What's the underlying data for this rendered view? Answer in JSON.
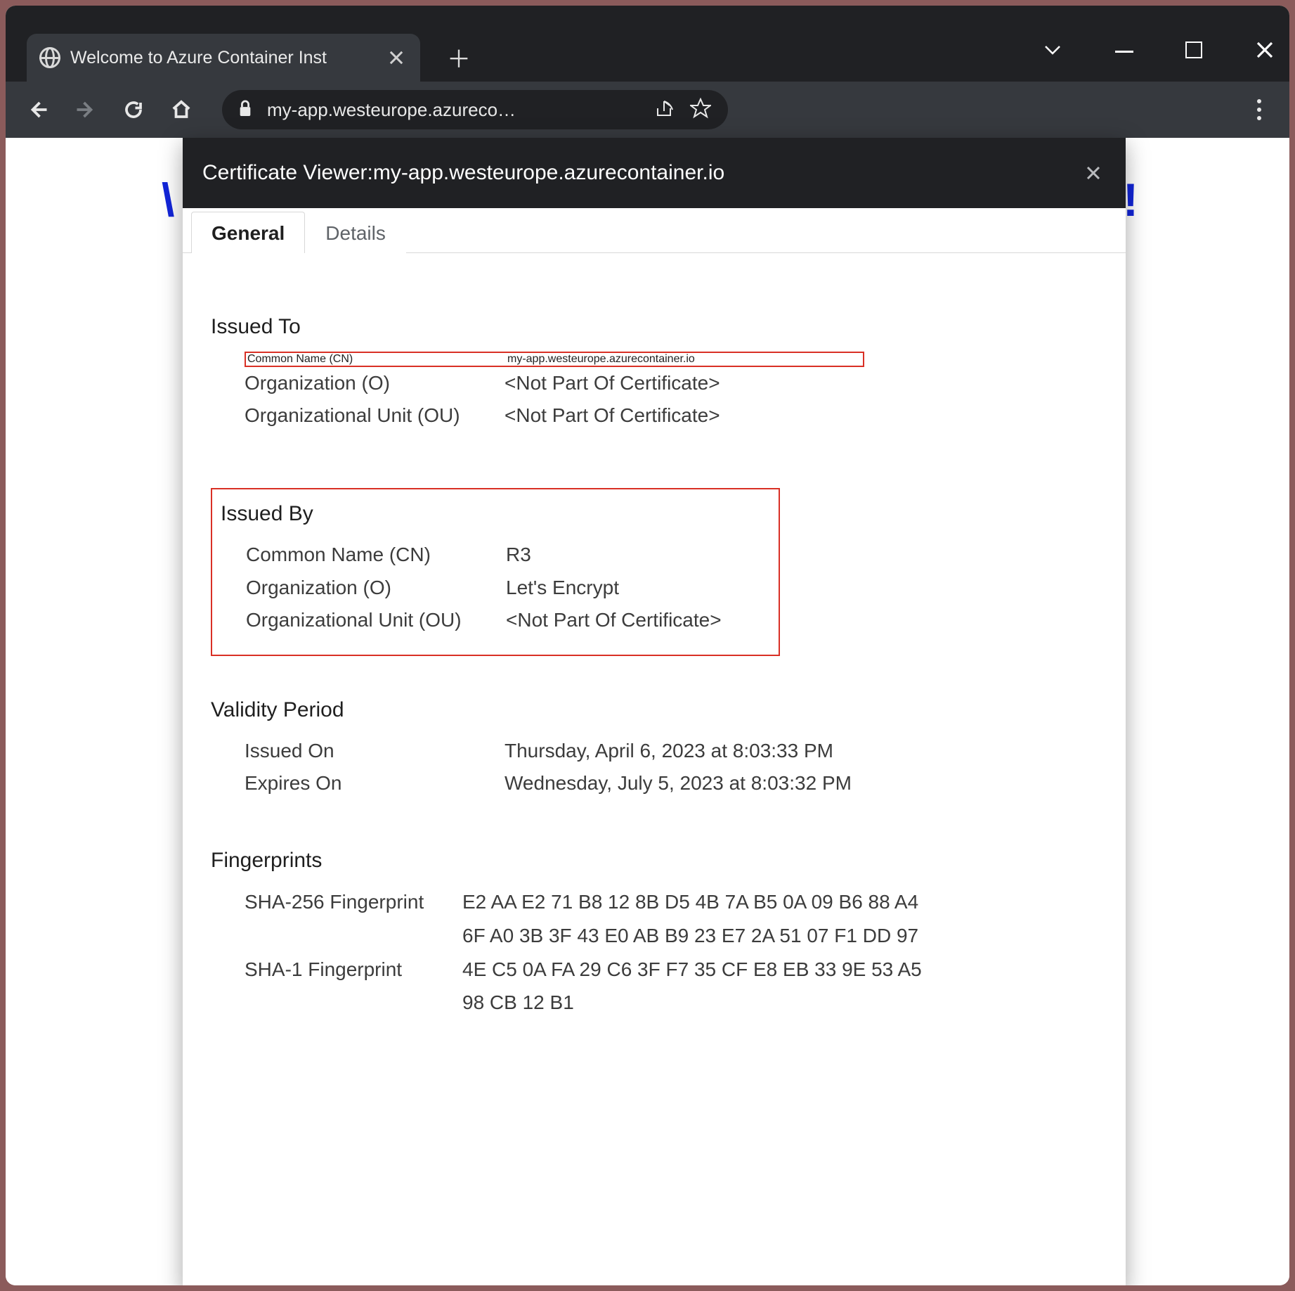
{
  "browser": {
    "tab_title": "Welcome to Azure Container Inst",
    "url_display": "my-app.westeurope.azureco…"
  },
  "dialog": {
    "title_prefix": "Certificate Viewer: ",
    "host": "my-app.westeurope.azurecontainer.io",
    "tabs": {
      "general": "General",
      "details": "Details"
    },
    "sections": {
      "issued_to": {
        "title": "Issued To",
        "cn_label": "Common Name (CN)",
        "cn_value": "my-app.westeurope.azurecontainer.io",
        "o_label": "Organization (O)",
        "o_value": "<Not Part Of Certificate>",
        "ou_label": "Organizational Unit (OU)",
        "ou_value": "<Not Part Of Certificate>"
      },
      "issued_by": {
        "title": "Issued By",
        "cn_label": "Common Name (CN)",
        "cn_value": "R3",
        "o_label": "Organization (O)",
        "o_value": "Let's Encrypt",
        "ou_label": "Organizational Unit (OU)",
        "ou_value": "<Not Part Of Certificate>"
      },
      "validity": {
        "title": "Validity Period",
        "issued_label": "Issued On",
        "issued_value": "Thursday, April 6, 2023 at 8:03:33 PM",
        "expires_label": "Expires On",
        "expires_value": "Wednesday, July 5, 2023 at 8:03:32 PM"
      },
      "fingerprints": {
        "title": "Fingerprints",
        "sha256_label": "SHA-256 Fingerprint",
        "sha256_line1": "E2 AA E2 71 B8 12 8B D5 4B 7A B5 0A 09 B6 88 A4",
        "sha256_line2": "6F A0 3B 3F 43 E0 AB B9 23 E7 2A 51 07 F1 DD 97",
        "sha1_label": "SHA-1 Fingerprint",
        "sha1_line1": "4E C5 0A FA 29 C6 3F F7 35 CF E8 EB 33 9E 53 A5",
        "sha1_line2": "98 CB 12 B1"
      }
    }
  },
  "page": {
    "heading_left_fragment": "\\",
    "heading_right_fragment": "!"
  }
}
